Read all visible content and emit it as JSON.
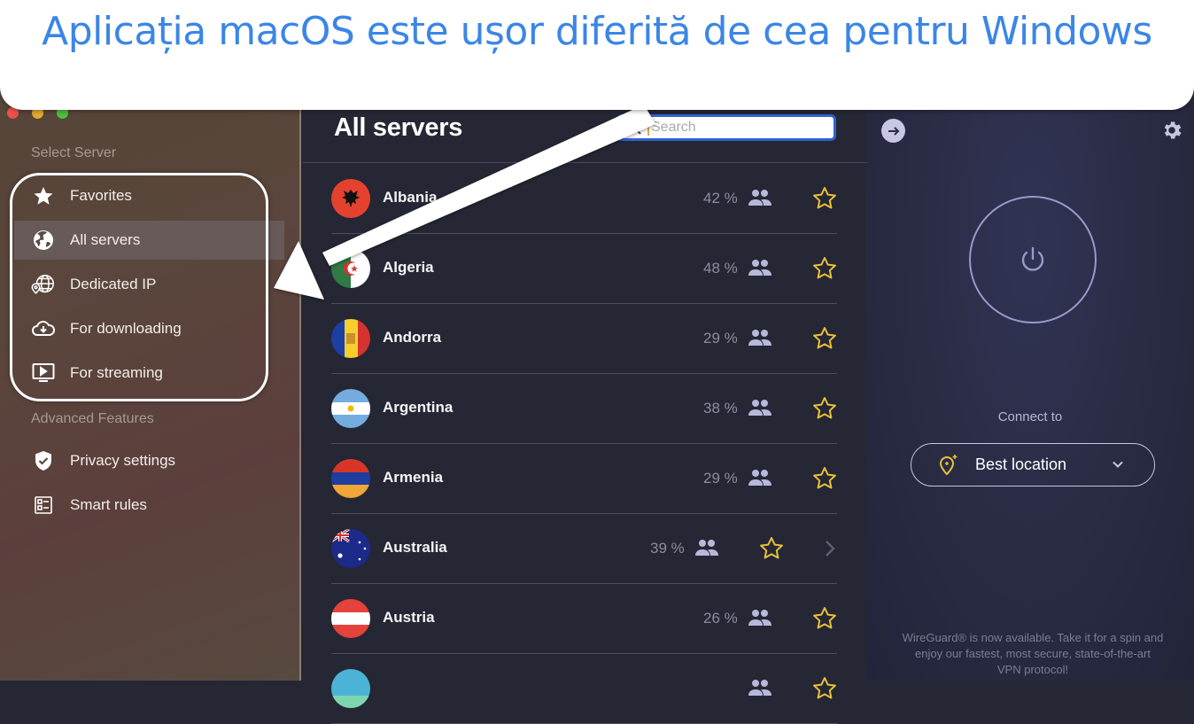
{
  "banner": {
    "text": "Aplicația macOS este ușor diferită de cea pentru Windows"
  },
  "sidebar": {
    "section_select": "Select Server",
    "items": [
      {
        "label": "Favorites",
        "icon": "star-icon"
      },
      {
        "label": "All servers",
        "icon": "globe-icon",
        "active": true
      },
      {
        "label": "Dedicated IP",
        "icon": "dedicated-ip-globe-icon"
      },
      {
        "label": "For downloading",
        "icon": "cloud-download-icon"
      },
      {
        "label": "For streaming",
        "icon": "tv-play-icon"
      }
    ],
    "section_advanced": "Advanced Features",
    "advanced_items": [
      {
        "label": "Privacy settings",
        "icon": "shield-check-icon"
      },
      {
        "label": "Smart rules",
        "icon": "rules-list-icon"
      }
    ]
  },
  "servers": {
    "title": "All servers",
    "search": {
      "placeholder": "Search",
      "value": ""
    },
    "rows": [
      {
        "country": "Albania",
        "load": "42 %"
      },
      {
        "country": "Algeria",
        "load": "48 %"
      },
      {
        "country": "Andorra",
        "load": "29 %"
      },
      {
        "country": "Argentina",
        "load": "38 %"
      },
      {
        "country": "Armenia",
        "load": "29 %"
      },
      {
        "country": "Australia",
        "load": "39 %",
        "has_submenu": true
      },
      {
        "country": "Austria",
        "load": "26 %"
      },
      {
        "country": "",
        "load": ""
      }
    ]
  },
  "connect": {
    "label": "Connect to",
    "location": "Best location",
    "promo": "WireGuard® is now available. Take it for a spin and enjoy our fastest, most secure, state-of-the-art VPN protocol!"
  },
  "colors": {
    "accent_star": "#e8c13a",
    "banner_text": "#3b86e6",
    "search_border": "#2f63d6"
  }
}
